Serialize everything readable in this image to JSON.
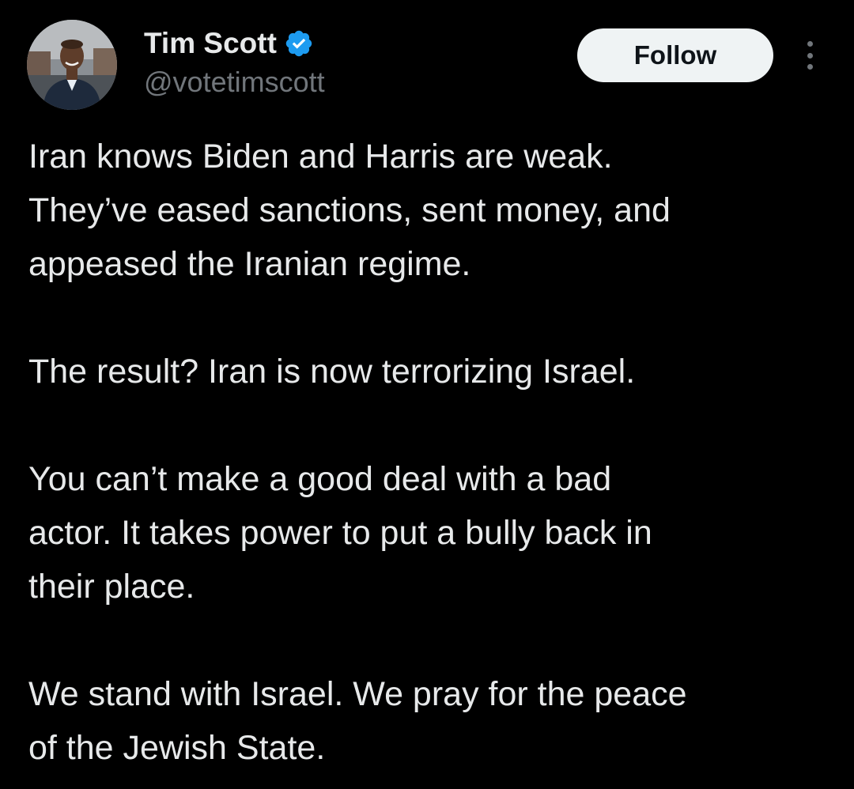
{
  "author": {
    "display_name": "Tim Scott",
    "handle": "@votetimscott",
    "verified": true,
    "avatar_icon": "profile-photo"
  },
  "actions": {
    "follow_label": "Follow",
    "more_icon": "more-options-icon"
  },
  "tweet": {
    "paragraphs": [
      {
        "lines": [
          "Iran knows Biden and Harris are weak.",
          "They’ve eased sanctions, sent money, and",
          "appeased the Iranian regime."
        ]
      },
      {
        "lines": [
          "The result? Iran is now terrorizing Israel."
        ]
      },
      {
        "lines": [
          "You can’t make a good deal with a bad",
          "actor. It takes power to put a bully back in",
          "their place."
        ]
      },
      {
        "lines": [
          "We stand with Israel. We pray for the peace",
          "of the Jewish State."
        ]
      }
    ]
  },
  "colors": {
    "background": "#000000",
    "text_primary": "#e7e9ea",
    "text_secondary": "#71767b",
    "verified_blue": "#1d9bf0",
    "follow_button_bg": "#eff3f4",
    "follow_button_text": "#0f1419"
  }
}
